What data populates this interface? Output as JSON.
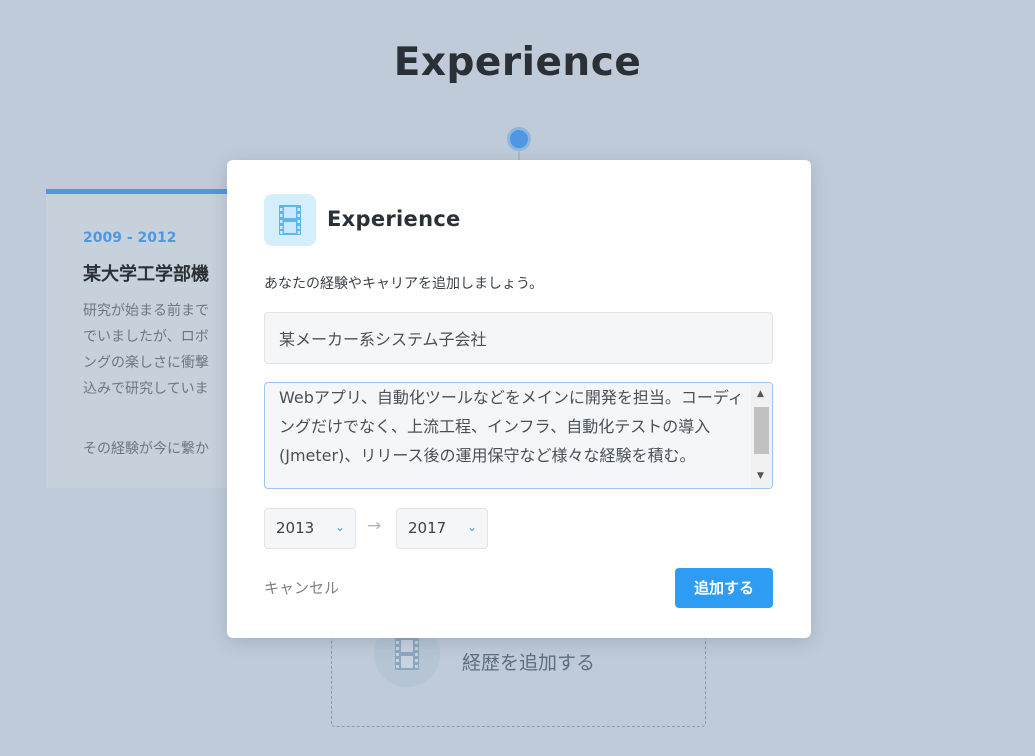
{
  "page": {
    "title": "Experience"
  },
  "background_card": {
    "period": "2009 - 2012",
    "heading": "某大学工学部機",
    "body_lines": [
      "研究が始まる前まで",
      "でいましたが、ロボ",
      "ングの楽しさに衝撃",
      "込みで研究していま"
    ],
    "footer": "その経験が今に繋か"
  },
  "add_area": {
    "label": "経歴を追加する",
    "icon": "film-icon"
  },
  "modal": {
    "icon": "film-icon",
    "title": "Experience",
    "description": "あなたの経験やキャリアを追加しましょう。",
    "company_value": "某メーカー系システム子会社",
    "description_text": "Webアプリ、自動化ツールなどをメインに開発を担当。コーディングだけでなく、上流工程、インフラ、自動化テストの導入(Jmeter)、リリース後の運用保守など様々な経験を積む。",
    "start_year": "2013",
    "end_year": "2017",
    "arrow": "→",
    "cancel_label": "キャンセル",
    "submit_label": "追加する"
  },
  "colors": {
    "accent": "#2e9cf3",
    "background": "#bfcbd8",
    "timeline": "#4f97e4"
  }
}
